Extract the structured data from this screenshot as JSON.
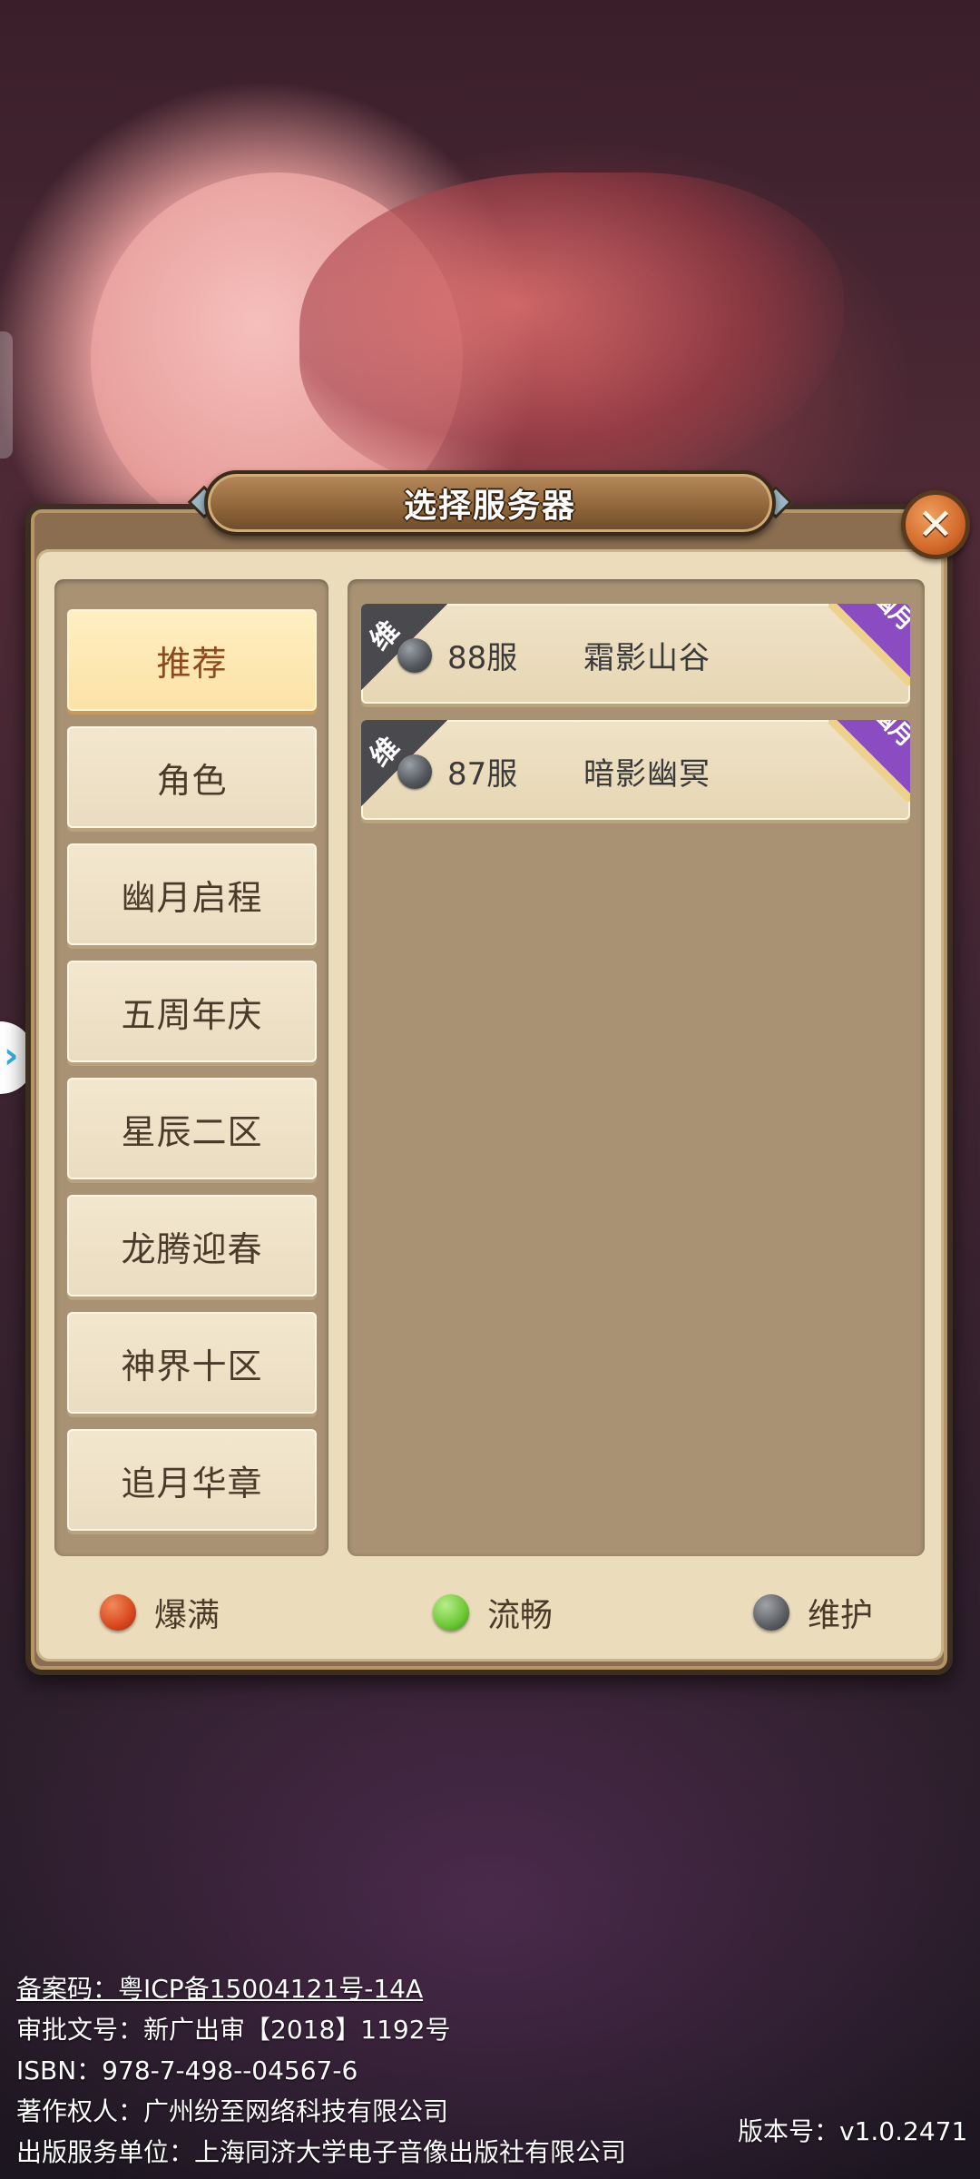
{
  "dialog": {
    "title": "选择服务器",
    "close_icon": "close-icon"
  },
  "categories": [
    {
      "label": "推荐",
      "active": true
    },
    {
      "label": "角色",
      "active": false
    },
    {
      "label": "幽月启程",
      "active": false
    },
    {
      "label": "五周年庆",
      "active": false
    },
    {
      "label": "星辰二区",
      "active": false
    },
    {
      "label": "龙腾迎春",
      "active": false
    },
    {
      "label": "神界十区",
      "active": false
    },
    {
      "label": "追月华章",
      "active": false
    }
  ],
  "servers": [
    {
      "status_tag": "维",
      "status": "维护",
      "number": "88服",
      "name": "霜影山谷",
      "corner_tag": "幽月"
    },
    {
      "status_tag": "维",
      "status": "维护",
      "number": "87服",
      "name": "暗影幽冥",
      "corner_tag": "幽月"
    }
  ],
  "legend": [
    {
      "label": "爆满",
      "color": "#d9481e"
    },
    {
      "label": "流畅",
      "color": "#6cc833"
    },
    {
      "label": "维护",
      "color": "#5a5d62"
    }
  ],
  "footer": {
    "lines": [
      "备案码：粤ICP备15004121号-14A",
      "审批文号：新广出审【2018】1192号",
      "ISBN：978-7-498--04567-6",
      "著作权人：广州纷至网络科技有限公司",
      "出版服务单位：上海同济大学电子音像出版社有限公司"
    ],
    "version": "版本号：v1.0.2471"
  }
}
